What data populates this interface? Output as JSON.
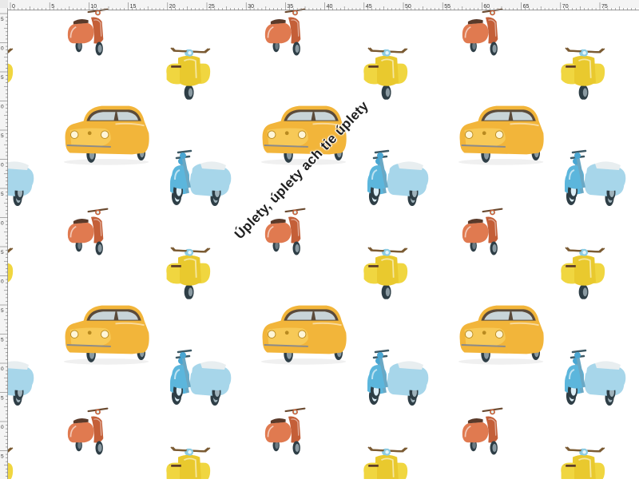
{
  "ruler": {
    "unit": "cm",
    "top_labels": [
      "0",
      "5",
      "10",
      "15",
      "20",
      "25",
      "30",
      "35",
      "40",
      "45",
      "50",
      "55",
      "60",
      "65",
      "70",
      "75"
    ],
    "left_labels": [
      "5",
      "0",
      "5",
      "0",
      "5",
      "0",
      "5",
      "0",
      "5",
      "0",
      "5",
      "5",
      "0",
      "5",
      "0",
      "5",
      "0"
    ]
  },
  "watermark": {
    "text": "Úplety, úplety ach tie úplety"
  },
  "pattern": {
    "motifs": [
      "orange-vespa-icon",
      "yellow-vespa-icon",
      "yellow-fiat-500-icon",
      "blue-vespa-icon"
    ],
    "colors": {
      "orange": "#e07a50",
      "yellow": "#f0d640",
      "car_yellow": "#f2b53a",
      "blue": "#5cb6dc",
      "tire": "#2e3e46"
    }
  }
}
